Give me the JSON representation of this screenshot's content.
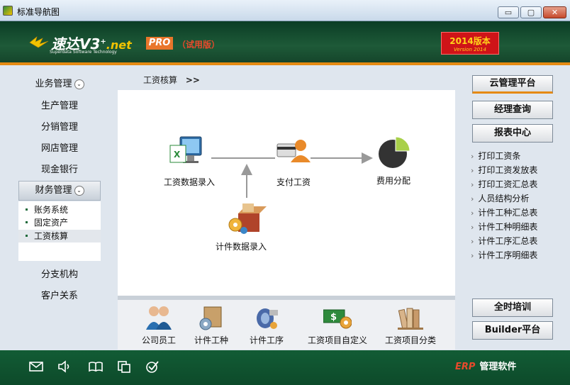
{
  "window": {
    "title": "标准导航图",
    "minimize": "▭",
    "maximize": "▢",
    "close": "✕"
  },
  "banner": {
    "logo_text": "速达V3",
    "logo_sup": "+",
    "logo_net": ".net",
    "logo_subtitle": "Superdata Software Technology",
    "pro_badge": "PRO",
    "trial_label": "（试用版）",
    "version_main": "2014版本",
    "version_sub": "Version 2014",
    "colors": {
      "banner": "#1e5a38",
      "accent": "#e58a12",
      "version_bg": "#cf1418"
    }
  },
  "sidebar": {
    "items": [
      {
        "label": "业务管理",
        "expandable": true
      },
      {
        "label": "生产管理"
      },
      {
        "label": "分销管理"
      },
      {
        "label": "网店管理"
      },
      {
        "label": "现金银行"
      },
      {
        "label": "财务管理",
        "expandable": true,
        "active": true
      },
      {
        "label": "分支机构"
      },
      {
        "label": "客户关系"
      }
    ],
    "chevron": "⌄",
    "subitems": [
      {
        "label": "账务系统"
      },
      {
        "label": "固定资产"
      },
      {
        "label": "工资核算",
        "selected": true
      }
    ]
  },
  "breadcrumb": {
    "label": "工资核算",
    "arrow": ">>"
  },
  "flow": {
    "nodes": [
      {
        "label": "工资数据录入",
        "icon": "excel-monitor-icon"
      },
      {
        "label": "支付工资",
        "icon": "person-card-icon"
      },
      {
        "label": "费用分配",
        "icon": "pie-chart-icon"
      },
      {
        "label": "计件数据录入",
        "icon": "gear-box-icon"
      }
    ]
  },
  "bottom_tools": [
    {
      "label": "公司员工",
      "icon": "staff-icon"
    },
    {
      "label": "计件工种",
      "icon": "wrench-gear-icon"
    },
    {
      "label": "计件工序",
      "icon": "process-icon"
    },
    {
      "label": "工资项目自定义",
      "icon": "money-gear-icon"
    },
    {
      "label": "工资项目分类",
      "icon": "books-icon"
    }
  ],
  "right_panel": {
    "buttons": [
      {
        "label": "云管理平台",
        "highlight": true
      },
      {
        "label": "经理查询"
      },
      {
        "label": "报表中心"
      }
    ],
    "reports": [
      {
        "label": "打印工资条"
      },
      {
        "label": "打印工资发放表"
      },
      {
        "label": "打印工资汇总表"
      },
      {
        "label": "人员结构分析"
      },
      {
        "label": "计件工种汇总表"
      },
      {
        "label": "计件工种明细表"
      },
      {
        "label": "计件工序汇总表"
      },
      {
        "label": "计件工序明细表"
      }
    ],
    "report_arrow": "›",
    "bottom_buttons": [
      {
        "label": "全时培训"
      },
      {
        "label": "Builder平台"
      }
    ]
  },
  "footer": {
    "icons": [
      "mail-icon",
      "speaker-icon",
      "book-icon",
      "copy-icon",
      "check-icon"
    ],
    "brand_erp": "ERP",
    "brand_text": "管理软件"
  }
}
